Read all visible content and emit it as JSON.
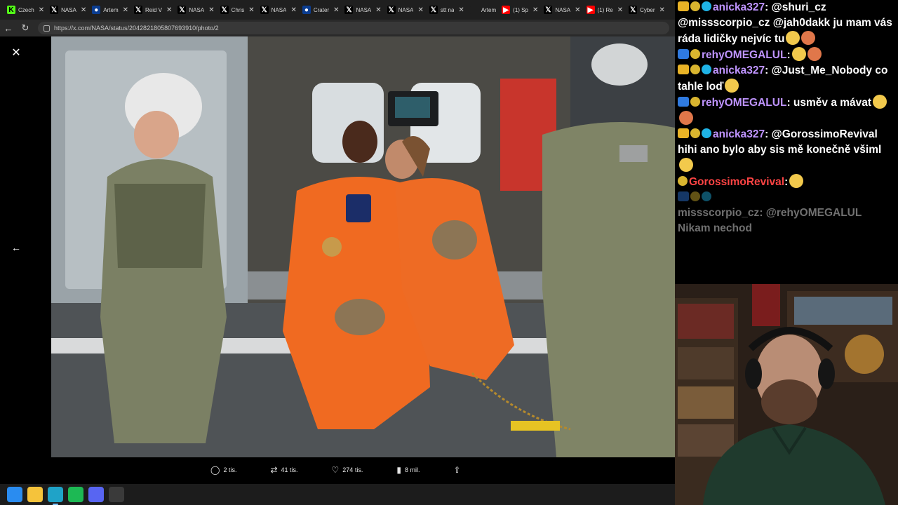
{
  "browser": {
    "tabs": [
      {
        "label": "Czech",
        "icon": "k-icon",
        "color": "#53fc18"
      },
      {
        "label": "NASA",
        "icon": "x-icon",
        "color": "#000000"
      },
      {
        "label": "Artem",
        "icon": "nasa-icon",
        "color": "#0b3d91"
      },
      {
        "label": "Reid V",
        "icon": "x-icon",
        "color": "#000000"
      },
      {
        "label": "NASA",
        "icon": "x-icon",
        "color": "#000000"
      },
      {
        "label": "Chris",
        "icon": "x-icon",
        "color": "#000000"
      },
      {
        "label": "NASA",
        "icon": "x-icon",
        "color": "#000000"
      },
      {
        "label": "Crater",
        "icon": "nasa-icon",
        "color": "#0b3d91"
      },
      {
        "label": "NASA",
        "icon": "x-icon",
        "color": "#000000"
      },
      {
        "label": "NASA",
        "icon": "x-icon",
        "color": "#000000"
      },
      {
        "label": "stt na",
        "icon": "x-icon",
        "color": "#000000"
      },
      {
        "label": "Artem",
        "icon": "",
        "color": "#1f1f1f"
      },
      {
        "label": "(1) Sp",
        "icon": "youtube-icon",
        "color": "#ff0000"
      },
      {
        "label": "NASA",
        "icon": "x-icon",
        "color": "#000000"
      },
      {
        "label": "(1) Re",
        "icon": "youtube-icon",
        "color": "#ff0000"
      },
      {
        "label": "Cyber",
        "icon": "x-icon",
        "color": "#000000"
      }
    ],
    "url": "https://x.com/NASA/status/2042821805807693910/photo/2"
  },
  "viewer": {
    "actions": [
      {
        "icon": "reply-icon",
        "glyph": "◯",
        "label": "2 tis."
      },
      {
        "icon": "repost-icon",
        "glyph": "⇄",
        "label": "41 tis."
      },
      {
        "icon": "like-icon",
        "glyph": "♡",
        "label": "274 tis."
      },
      {
        "icon": "views-icon",
        "glyph": "▮",
        "label": "8 mil."
      },
      {
        "icon": "share-icon",
        "glyph": "⇧",
        "label": ""
      }
    ]
  },
  "taskbar": {
    "items": [
      {
        "icon": "windows-start-icon",
        "color": "#2a8cf0"
      },
      {
        "icon": "file-explorer-icon",
        "color": "#f5c33b"
      },
      {
        "icon": "edge-icon",
        "color": "#1fa3c8"
      },
      {
        "icon": "spotify-icon",
        "color": "#1db954"
      },
      {
        "icon": "discord-icon",
        "color": "#5865f2"
      },
      {
        "icon": "obs-icon",
        "color": "#3a3a3a"
      }
    ]
  },
  "chat": {
    "messages": [
      {
        "user": "anicka327",
        "user_color": "#bf94ff",
        "badges": [
          "crown",
          "pepe",
          "gem"
        ],
        "text": ": @shuri_cz @missscorpio_cz @jah0dakk ju mam vás ráda lidičky nejvíc tu",
        "emotes": 2,
        "faded": false
      },
      {
        "user": "rehyOMEGALUL",
        "user_color": "#bf94ff",
        "badges": [
          "arrow",
          "pepe"
        ],
        "text": ":",
        "emotes": 2,
        "faded": false
      },
      {
        "user": "anicka327",
        "user_color": "#bf94ff",
        "badges": [
          "crown",
          "pepe",
          "gem"
        ],
        "text": ": @Just_Me_Nobody co tahle loď",
        "emotes": 1,
        "faded": false
      },
      {
        "user": "rehyOMEGALUL",
        "user_color": "#bf94ff",
        "badges": [
          "arrow",
          "pepe"
        ],
        "text": ": usměv a mávat",
        "emotes": 2,
        "faded": false
      },
      {
        "user": "anicka327",
        "user_color": "#bf94ff",
        "badges": [
          "crown",
          "pepe",
          "gem"
        ],
        "text": ": @GorossimoRevival hihi ano bylo aby sis mě konečně všiml",
        "emotes": 1,
        "faded": false
      },
      {
        "user": "GorossimoRevival",
        "user_color": "#ff4444",
        "badges": [
          "pepe"
        ],
        "text": ":",
        "emotes": 1,
        "faded": false
      },
      {
        "user": "",
        "user_color": "#707070",
        "badges": [
          "arrow",
          "pepe",
          "gem"
        ],
        "text": "",
        "emotes": 0,
        "faded": true
      },
      {
        "user": "missscorpio_cz",
        "user_color": "#707070",
        "badges": [],
        "text": ": @rehyOMEGALUL Nikam nechod",
        "emotes": 0,
        "faded": true
      }
    ]
  }
}
